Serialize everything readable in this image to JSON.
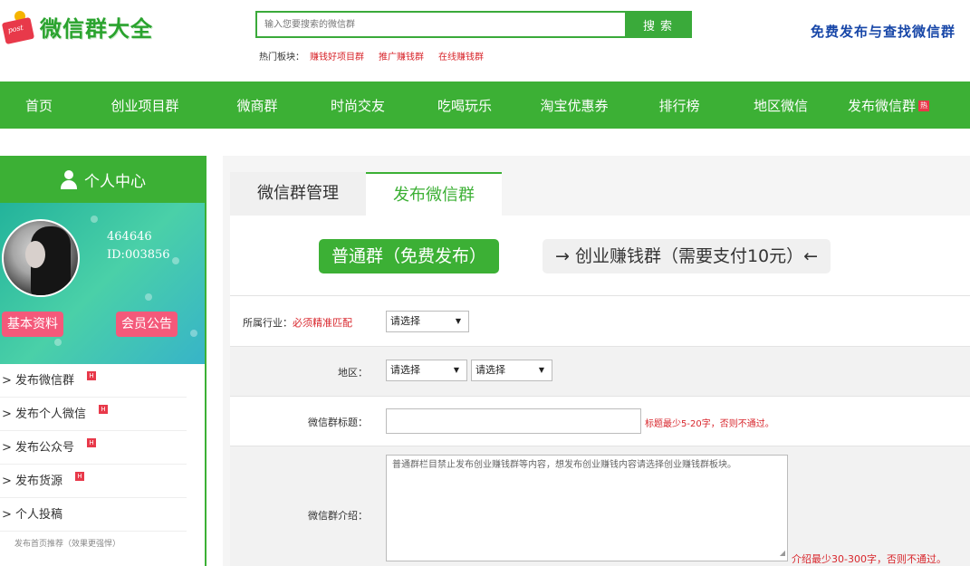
{
  "header": {
    "logo_badge": "post",
    "logo_text": "微信群大全",
    "search_placeholder": "输入您要搜索的微信群",
    "search_button": "搜索",
    "hot_label": "热门板块：",
    "hot_links": [
      "赚钱好项目群",
      "推广赚钱群",
      "在线赚钱群"
    ],
    "slogan": "免费发布与查找微信群"
  },
  "nav": {
    "items": [
      "首页",
      "创业项目群",
      "微商群",
      "时尚交友",
      "吃喝玩乐",
      "淘宝优惠券",
      "排行榜",
      "地区微信",
      "发布微信群"
    ],
    "hot_badge": "热"
  },
  "sidebar": {
    "title": "个人中心",
    "username": "464646",
    "user_id": "ID:003856",
    "profile_button": "基本资料",
    "notice_button": "会员公告",
    "hot_badge": "H",
    "menu": [
      "> 发布微信群",
      "> 发布个人微信",
      "> 发布公众号",
      "> 发布货源",
      "> 个人投稿"
    ],
    "note": "发布首页推荐（效果更强悍）"
  },
  "main": {
    "tabs": [
      "微信群管理",
      "发布微信群"
    ],
    "type_free": "普通群（免费发布）",
    "type_paid": "→ 创业赚钱群（需要支付10元）←",
    "industry_label": "所属行业：",
    "industry_required": "必须精准匹配",
    "select_default": "请选择",
    "region_label": "地区：",
    "title_label": "微信群标题：",
    "title_hint": "标题最少5-20字，否则不通过。",
    "intro_label": "微信群介绍：",
    "intro_value": "普通群栏目禁止发布创业赚钱群等内容，想发布创业赚钱内容请选择创业赚钱群板块。",
    "intro_hint": "介绍最少30-300字，否则不通过。"
  },
  "colors": {
    "brand_green": "#3cb035",
    "alert_red": "#d8262c",
    "slogan_blue": "#1847a8"
  }
}
